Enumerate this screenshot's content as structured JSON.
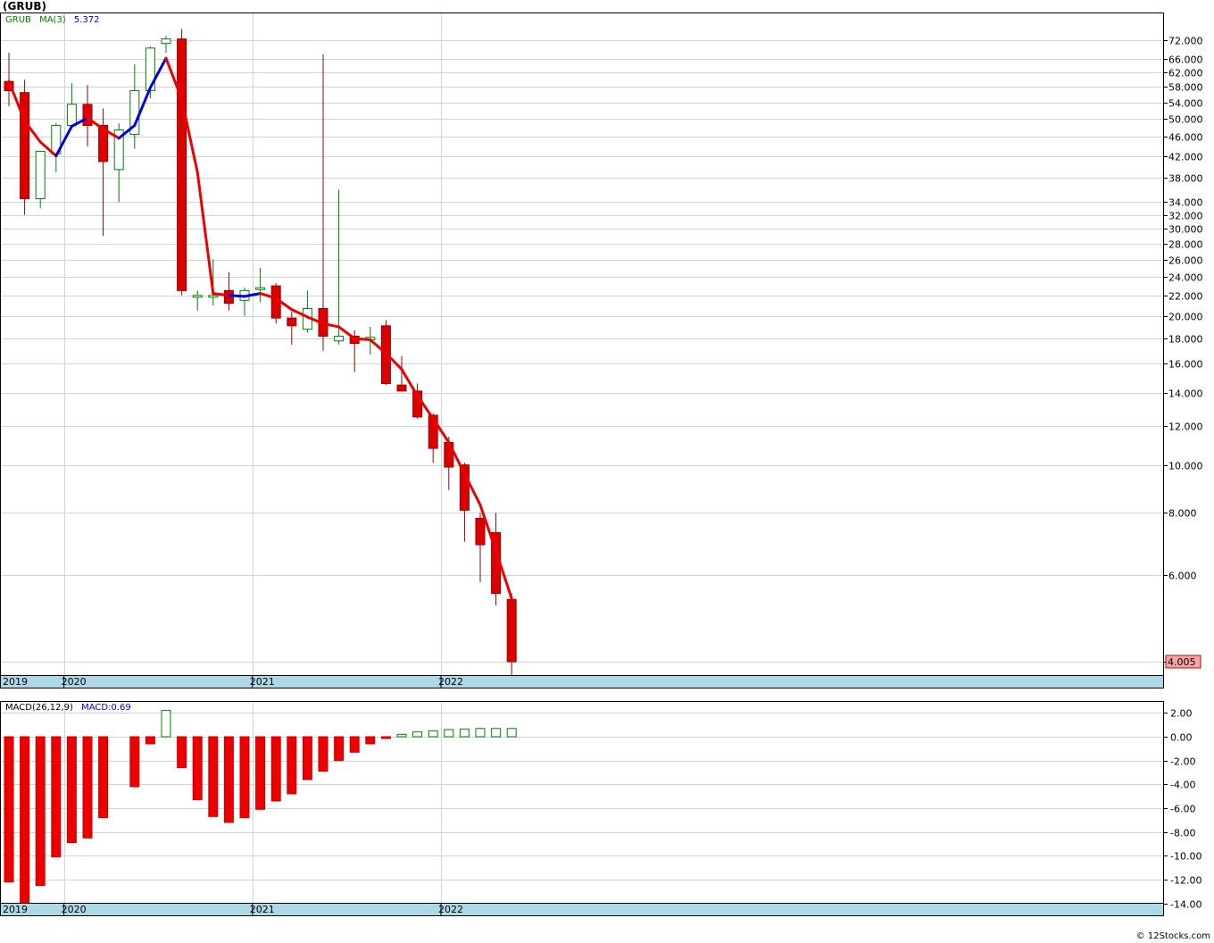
{
  "title": "(GRUB)",
  "footer": "© 12Stocks.com",
  "colors": {
    "up": "#008000",
    "down": "#dd0000",
    "ma_up": "#0000dd",
    "ma_down": "#ee0000",
    "macd_pos_border": "#008000",
    "macd_neg_fill": "#ee0000",
    "axis_band": "#add8e6",
    "grid": "#d3d3d3",
    "last_price_bg": "#f4a6a6"
  },
  "chart_data": [
    {
      "type": "candlestick",
      "legend": {
        "symbol": "GRUB",
        "ma_label": "MA(3)",
        "ma_value": "5.372"
      },
      "last_price_label": "4.005",
      "y_scale": "log",
      "ylim": [
        3.55,
        82
      ],
      "y_ticks": [
        4,
        6,
        8,
        10,
        12,
        14,
        16,
        18,
        20,
        22,
        24,
        26,
        28,
        30,
        32,
        34,
        38,
        42,
        46,
        50,
        54,
        58,
        62,
        66,
        72
      ],
      "y_tick_labels": [
        "4.000",
        "6.000",
        "8.000",
        "10.000",
        "12.000",
        "14.000",
        "16.000",
        "18.000",
        "20.000",
        "22.000",
        "24.000",
        "26.000",
        "28.000",
        "30.000",
        "32.000",
        "34.000",
        "38.000",
        "42.000",
        "46.000",
        "50.000",
        "54.000",
        "58.000",
        "62.000",
        "66.000",
        "72.000"
      ],
      "year_labels": [
        {
          "label": "2019",
          "index": 0
        },
        {
          "label": "2020",
          "index": 4
        },
        {
          "label": "2021",
          "index": 16
        },
        {
          "label": "2022",
          "index": 28
        }
      ],
      "candles": [
        {
          "o": 59.5,
          "h": 68.0,
          "l": 53.0,
          "c": 57.0
        },
        {
          "o": 56.5,
          "h": 60.0,
          "l": 32.0,
          "c": 34.5
        },
        {
          "o": 34.5,
          "h": 43.0,
          "l": 33.0,
          "c": 43.0
        },
        {
          "o": 42.5,
          "h": 49.0,
          "l": 39.0,
          "c": 48.5
        },
        {
          "o": 48.5,
          "h": 59.0,
          "l": 48.0,
          "c": 53.5
        },
        {
          "o": 53.5,
          "h": 58.5,
          "l": 44.0,
          "c": 48.5
        },
        {
          "o": 48.5,
          "h": 52.5,
          "l": 29.0,
          "c": 41.0
        },
        {
          "o": 39.5,
          "h": 49.0,
          "l": 34.0,
          "c": 47.5
        },
        {
          "o": 46.5,
          "h": 64.5,
          "l": 43.5,
          "c": 57.0
        },
        {
          "o": 57.0,
          "h": 70.0,
          "l": 55.0,
          "c": 69.5
        },
        {
          "o": 71.0,
          "h": 73.5,
          "l": 68.0,
          "c": 72.5
        },
        {
          "o": 72.5,
          "h": 76.0,
          "l": 22.0,
          "c": 22.5
        },
        {
          "o": 22.0,
          "h": 22.5,
          "l": 20.5,
          "c": 22.0
        },
        {
          "o": 22.0,
          "h": 26.0,
          "l": 21.0,
          "c": 22.0
        },
        {
          "o": 22.5,
          "h": 24.5,
          "l": 20.5,
          "c": 21.2
        },
        {
          "o": 21.5,
          "h": 22.8,
          "l": 20.0,
          "c": 22.5
        },
        {
          "o": 22.8,
          "h": 25.0,
          "l": 21.3,
          "c": 22.8
        },
        {
          "o": 23.0,
          "h": 23.3,
          "l": 19.3,
          "c": 19.8
        },
        {
          "o": 19.8,
          "h": 20.4,
          "l": 17.5,
          "c": 19.1
        },
        {
          "o": 18.8,
          "h": 22.5,
          "l": 18.5,
          "c": 20.7
        },
        {
          "o": 20.7,
          "h": 67.5,
          "l": 17.0,
          "c": 18.2
        },
        {
          "o": 17.8,
          "h": 36.0,
          "l": 17.5,
          "c": 18.2
        },
        {
          "o": 18.2,
          "h": 18.7,
          "l": 15.4,
          "c": 17.6
        },
        {
          "o": 17.9,
          "h": 19.0,
          "l": 16.7,
          "c": 18.1
        },
        {
          "o": 19.1,
          "h": 19.6,
          "l": 14.5,
          "c": 14.6
        },
        {
          "o": 14.5,
          "h": 16.6,
          "l": 14.3,
          "c": 14.1
        },
        {
          "o": 14.1,
          "h": 14.6,
          "l": 12.4,
          "c": 12.5
        },
        {
          "o": 12.6,
          "h": 12.7,
          "l": 10.1,
          "c": 10.8
        },
        {
          "o": 11.1,
          "h": 11.4,
          "l": 8.9,
          "c": 9.9
        },
        {
          "o": 10.0,
          "h": 10.1,
          "l": 7.0,
          "c": 8.1
        },
        {
          "o": 7.8,
          "h": 8.0,
          "l": 5.8,
          "c": 6.9
        },
        {
          "o": 7.3,
          "h": 8.0,
          "l": 5.2,
          "c": 5.5
        },
        {
          "o": 5.35,
          "h": 5.5,
          "l": 3.7,
          "c": 4.005
        }
      ],
      "ma3": [
        59.5,
        49.5,
        44.9,
        42.1,
        48.3,
        50.2,
        47.7,
        45.7,
        48.5,
        57.8,
        66.3,
        54.8,
        39.0,
        22.2,
        22.0,
        21.9,
        22.2,
        21.7,
        20.6,
        19.9,
        19.3,
        19.0,
        18.0,
        17.9,
        16.8,
        15.6,
        13.8,
        12.4,
        11.1,
        9.6,
        8.3,
        6.7,
        5.372
      ],
      "ma3_trend": [
        "down",
        "down",
        "down",
        "down",
        "up",
        "up",
        "down",
        "down",
        "up",
        "up",
        "up",
        "down",
        "down",
        "down",
        "down",
        "up",
        "up",
        "down",
        "down",
        "down",
        "down",
        "down",
        "down",
        "down",
        "down",
        "down",
        "down",
        "down",
        "down",
        "down",
        "down",
        "down",
        "down"
      ]
    },
    {
      "type": "bar",
      "legend": {
        "label": "MACD(26,12,9)",
        "value_label": "MACD:0.69"
      },
      "ylim": [
        -15,
        3
      ],
      "y_ticks": [
        2,
        0,
        -2,
        -4,
        -6,
        -8,
        -10,
        -12,
        -14
      ],
      "y_tick_labels": [
        "2.00",
        "0.00",
        "-2.00",
        "-4.00",
        "-6.00",
        "-8.00",
        "-10.00",
        "-12.00",
        "-14.00"
      ],
      "values": [
        -12.2,
        -14.6,
        -12.5,
        -10.1,
        -8.9,
        -8.5,
        -6.8,
        0,
        -4.2,
        -0.6,
        2.2,
        -2.6,
        -5.3,
        -6.7,
        -7.2,
        -6.8,
        -6.1,
        -5.4,
        -4.8,
        -3.6,
        -2.9,
        -2.0,
        -1.3,
        -0.6,
        -0.15,
        0.2,
        0.4,
        0.5,
        0.6,
        0.65,
        0.69,
        0.69,
        0.69
      ],
      "year_labels": [
        {
          "label": "2019",
          "index": 0
        },
        {
          "label": "2020",
          "index": 4
        },
        {
          "label": "2021",
          "index": 16
        },
        {
          "label": "2022",
          "index": 28
        }
      ]
    }
  ]
}
